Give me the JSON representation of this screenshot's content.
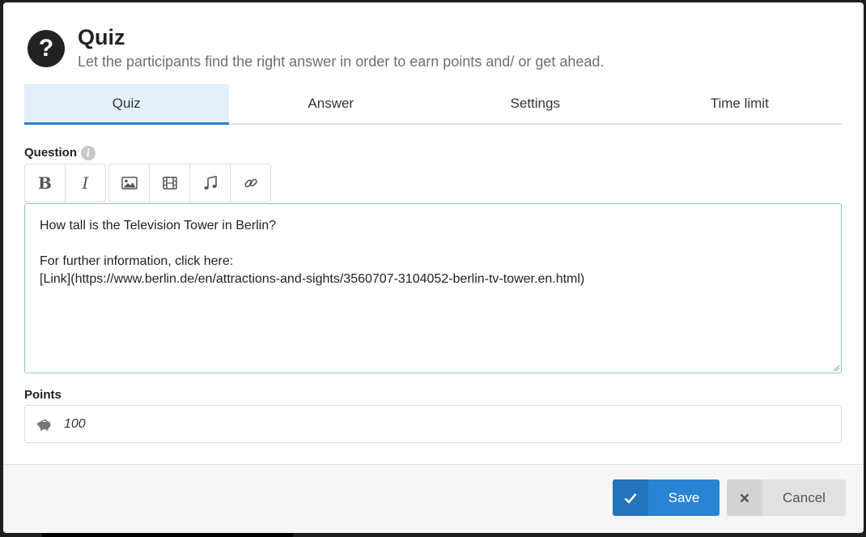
{
  "dialog": {
    "title": "Quiz",
    "subtitle": "Let the participants find the right answer in order to earn points and/ or get ahead.",
    "header_icon": "question-circle-icon"
  },
  "tabs": [
    {
      "label": "Quiz",
      "active": true
    },
    {
      "label": "Answer",
      "active": false
    },
    {
      "label": "Settings",
      "active": false
    },
    {
      "label": "Time limit",
      "active": false
    }
  ],
  "question": {
    "label": "Question",
    "toolbar": {
      "bold": "B",
      "italic": "I",
      "media_icons": [
        "image-icon",
        "film-icon",
        "music-icon",
        "link-icon"
      ]
    },
    "text": "How tall is the Television Tower in Berlin?\n\nFor further information, click here:\n[Link](https://www.berlin.de/en/attractions-and-sights/3560707-3104052-berlin-tv-tower.en.html)"
  },
  "points": {
    "label": "Points",
    "value": "100",
    "icon": "piggy-bank-icon"
  },
  "footer": {
    "save_label": "Save",
    "cancel_label": "Cancel"
  },
  "colors": {
    "accent": "#2a84d4",
    "active_tab_bg": "#e1f0fb",
    "cancel_bg": "#e2e2e2"
  }
}
